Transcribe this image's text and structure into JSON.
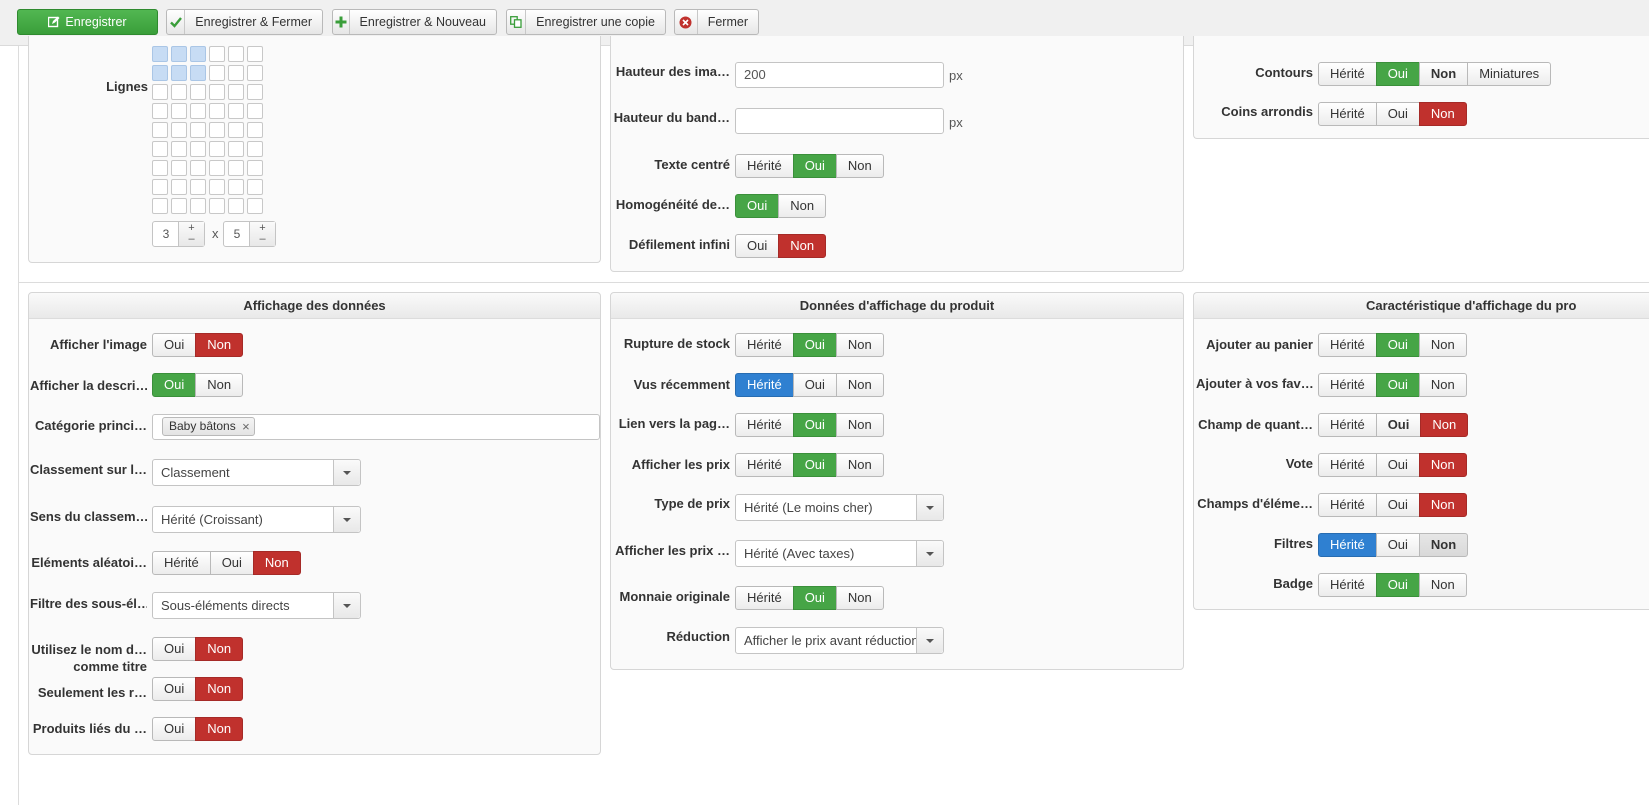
{
  "toolbar": {
    "save": "Enregistrer",
    "save_close": "Enregistrer & Fermer",
    "save_new": "Enregistrer & Nouveau",
    "save_copy": "Enregistrer une copie",
    "close": "Fermer"
  },
  "layout_panel": {
    "lines_label": "Lignes",
    "grid_selected": {
      "cols": 3,
      "rows": 2
    },
    "cols_value": "3",
    "times": "x",
    "rows_value": "5",
    "plus": "+",
    "minus": "–"
  },
  "image_panel": {
    "image_height_label": "Hauteur des ima…",
    "image_height_value": "200",
    "unit": "px",
    "banner_height_label": "Hauteur du band…",
    "banner_height_value": "",
    "center_text_label": "Texte centré",
    "homogeneity_label": "Homogénéité de…",
    "infinite_scroll_label": "Défilement infini"
  },
  "border_panel": {
    "contours_label": "Contours",
    "rounded_label": "Coins arrondis",
    "miniatures": "Miniatures"
  },
  "opts": {
    "inherited": "Hérité",
    "yes": "Oui",
    "no": "Non"
  },
  "data_panel": {
    "title": "Affichage des données",
    "show_image": "Afficher l'image",
    "show_description": "Afficher la descri…",
    "main_category": "Catégorie princi…",
    "category_tag": "Baby bâtons",
    "sort_on": "Classement sur l…",
    "sort_on_value": "Classement",
    "sort_direction": "Sens du classem…",
    "sort_direction_value": "Hérité (Croissant)",
    "random_items": "Eléments aléatoi…",
    "subitem_filter": "Filtre des sous-él…",
    "subitem_filter_value": "Sous-éléments directs",
    "use_name_line1": "Utilisez le nom d…",
    "use_name_line2": "comme titre",
    "only": "Seulement les r…",
    "related_products": "Produits liés du …"
  },
  "product_panel": {
    "title": "Données d'affichage du produit",
    "out_of_stock": "Rupture de stock",
    "recently_viewed": "Vus récemment",
    "page_link": "Lien vers la pag…",
    "show_prices": "Afficher les prix",
    "price_type": "Type de prix",
    "price_type_value": "Hérité (Le moins cher)",
    "show_prices_tax": "Afficher les prix …",
    "show_prices_tax_value": "Hérité (Avec taxes)",
    "original_currency": "Monnaie originale",
    "discount": "Réduction",
    "discount_value": "Afficher le prix avant réduction"
  },
  "feature_panel": {
    "title": "Caractéristique d'affichage du pro",
    "add_to_cart": "Ajouter au panier",
    "add_to_favorites": "Ajouter à vos fav…",
    "quantity_field": "Champ de quant…",
    "vote": "Vote",
    "item_fields": "Champs d'éléme…",
    "filters": "Filtres",
    "badge": "Badge"
  },
  "colors": {
    "green": "#46a546",
    "red": "#c0312d",
    "blue": "#2f80d1"
  }
}
